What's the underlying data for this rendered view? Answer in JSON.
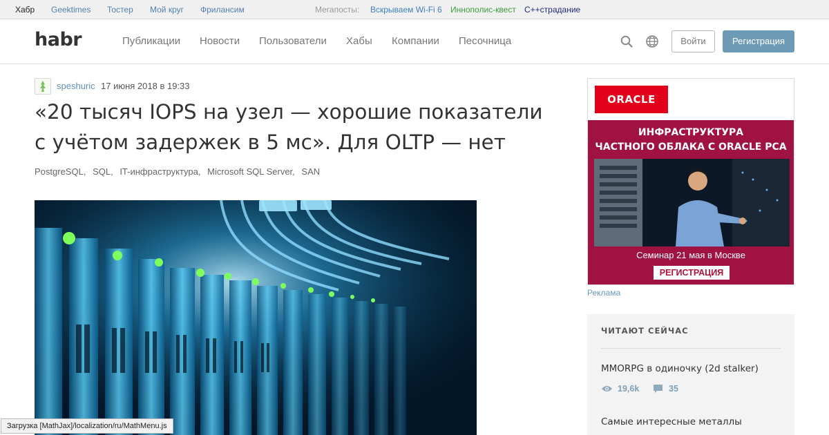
{
  "topbar": {
    "services": [
      "Хабр",
      "Geektimes",
      "Тостер",
      "Мой круг",
      "Фрилансим"
    ],
    "megaposts_label": "Мегапосты:",
    "megaposts": [
      {
        "label": "Вскрываем Wi-Fi 6",
        "color": "#3d7fc4"
      },
      {
        "label": "Иннополис-квест",
        "color": "#3c9b3c"
      },
      {
        "label": "С++страдание",
        "color": "#1f2a80"
      }
    ]
  },
  "header": {
    "logo": "habr",
    "nav": [
      "Публикации",
      "Новости",
      "Пользователи",
      "Хабы",
      "Компании",
      "Песочница"
    ],
    "icons": [
      "search-icon",
      "globe-icon"
    ],
    "login_label": "Войти",
    "register_label": "Регистрация"
  },
  "article": {
    "author": "speshuric",
    "date": "17 июня 2018 в 19:33",
    "title": "«20 тысяч IOPS на узел — хорошие показатели с учётом задержек в 5 мс». Для OLTP — нет",
    "hubs": [
      "PostgreSQL,",
      "SQL,",
      "IT-инфраструктура,",
      "Microsoft SQL Server,",
      "SAN"
    ]
  },
  "sidebar": {
    "ad": {
      "brand": "ORACLE",
      "headline_line1": "ИНФРАСТРУКТУРА",
      "headline_line2": "ЧАСТНОГО ОБЛАКА С ORACLE PCA",
      "seminar": "Семинар 21 мая в Москве",
      "cta": "РЕГИСТРАЦИЯ",
      "label": "Реклама",
      "brand_color": "#e3001a",
      "bg_color": "#a01242"
    },
    "reading_now": {
      "title": "ЧИТАЮТ СЕЙЧАС",
      "posts": [
        {
          "title": "MMORPG в одиночку (2d stalker)",
          "views": "19,6k",
          "comments": "35"
        },
        {
          "title": "Самые интересные металлы"
        }
      ]
    }
  },
  "status_bar": "Загрузка [MathJax]/localization/ru/MathMenu.js"
}
